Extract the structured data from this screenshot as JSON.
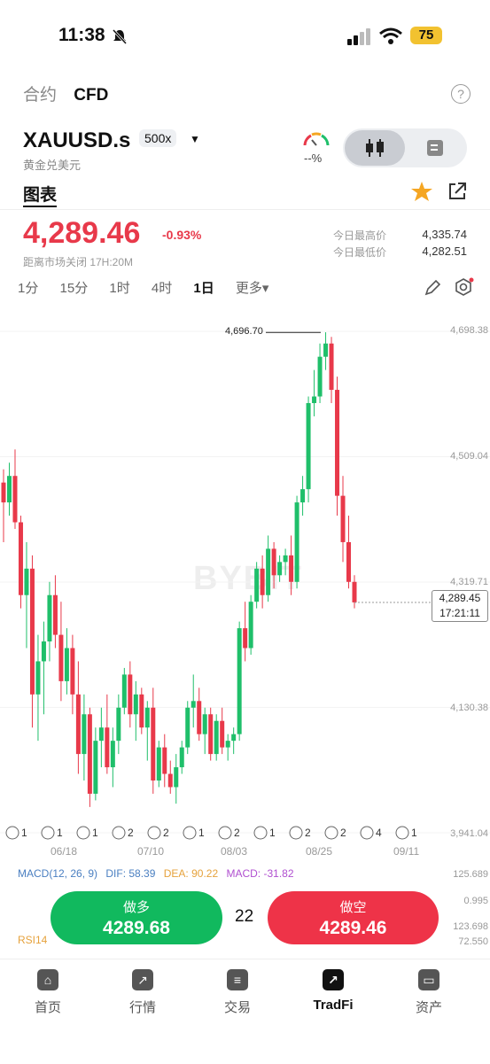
{
  "status": {
    "time": "11:38",
    "battery": "75"
  },
  "header": {
    "tabs": [
      "合约",
      "CFD"
    ],
    "active_tab": 1
  },
  "symbol": {
    "name": "XAUUSD.s",
    "leverage": "500x",
    "description": "黄金兑美元",
    "sentiment": "--%"
  },
  "chart_tab": "图表",
  "quote": {
    "price": "4,289.46",
    "change": "-0.93%",
    "close_note": "距离市场关闭 17H:20M",
    "high_label": "今日最高价",
    "high": "4,335.74",
    "low_label": "今日最低价",
    "low": "4,282.51"
  },
  "intervals": [
    "1分",
    "15分",
    "1时",
    "4时",
    "1日",
    "更多▾"
  ],
  "active_interval": "1日",
  "chart_data": {
    "type": "candlestick",
    "ylim": [
      3941.04,
      4698.38
    ],
    "y_ticks": [
      "4,698.38",
      "4,509.04",
      "4,319.71",
      "4,130.38",
      "3,941.04"
    ],
    "x_ticks": [
      "06/18",
      "07/10",
      "08/03",
      "08/25",
      "09/11"
    ],
    "peak_label": "4,696.70",
    "last_price": "4,289.45",
    "countdown": "17:21:11",
    "watermark": "BYBIT",
    "candles": [
      [
        4470,
        4490,
        4380,
        4440
      ],
      [
        4440,
        4500,
        4420,
        4480
      ],
      [
        4480,
        4520,
        4400,
        4410
      ],
      [
        4410,
        4420,
        4280,
        4300
      ],
      [
        4300,
        4380,
        4220,
        4340
      ],
      [
        4340,
        4360,
        4100,
        4150
      ],
      [
        4150,
        4240,
        4080,
        4200
      ],
      [
        4200,
        4260,
        4120,
        4230
      ],
      [
        4230,
        4320,
        4200,
        4300
      ],
      [
        4300,
        4330,
        4220,
        4240
      ],
      [
        4240,
        4290,
        4140,
        4170
      ],
      [
        4170,
        4250,
        4150,
        4220
      ],
      [
        4220,
        4240,
        4120,
        4150
      ],
      [
        4150,
        4200,
        4030,
        4060
      ],
      [
        4060,
        4150,
        4020,
        4120
      ],
      [
        4120,
        4130,
        3980,
        4000
      ],
      [
        4000,
        4100,
        3990,
        4080
      ],
      [
        4080,
        4130,
        4040,
        4100
      ],
      [
        4100,
        4150,
        4030,
        4040
      ],
      [
        4040,
        4100,
        4010,
        4080
      ],
      [
        4080,
        4150,
        4060,
        4130
      ],
      [
        4130,
        4190,
        4120,
        4180
      ],
      [
        4180,
        4200,
        4100,
        4120
      ],
      [
        4120,
        4170,
        4080,
        4150
      ],
      [
        4150,
        4160,
        4090,
        4100
      ],
      [
        4100,
        4140,
        4050,
        4130
      ],
      [
        4130,
        4160,
        4000,
        4020
      ],
      [
        4020,
        4080,
        4010,
        4070
      ],
      [
        4070,
        4090,
        4010,
        4030
      ],
      [
        4030,
        4050,
        4000,
        4010
      ],
      [
        4010,
        4060,
        3985,
        4040
      ],
      [
        4040,
        4080,
        4030,
        4070
      ],
      [
        4070,
        4140,
        4060,
        4130
      ],
      [
        4130,
        4180,
        4100,
        4140
      ],
      [
        4140,
        4160,
        4080,
        4090
      ],
      [
        4090,
        4130,
        4060,
        4120
      ],
      [
        4120,
        4130,
        4050,
        4060
      ],
      [
        4060,
        4120,
        4050,
        4110
      ],
      [
        4110,
        4130,
        4060,
        4070
      ],
      [
        4070,
        4090,
        4050,
        4080
      ],
      [
        4080,
        4100,
        4060,
        4090
      ],
      [
        4090,
        4260,
        4080,
        4250
      ],
      [
        4250,
        4290,
        4200,
        4220
      ],
      [
        4220,
        4300,
        4210,
        4290
      ],
      [
        4290,
        4350,
        4280,
        4340
      ],
      [
        4340,
        4360,
        4280,
        4300
      ],
      [
        4300,
        4390,
        4290,
        4370
      ],
      [
        4370,
        4380,
        4310,
        4330
      ],
      [
        4330,
        4360,
        4320,
        4350
      ],
      [
        4350,
        4370,
        4330,
        4360
      ],
      [
        4360,
        4390,
        4300,
        4320
      ],
      [
        4320,
        4450,
        4310,
        4440
      ],
      [
        4440,
        4480,
        4420,
        4460
      ],
      [
        4460,
        4600,
        4440,
        4590
      ],
      [
        4590,
        4640,
        4570,
        4600
      ],
      [
        4600,
        4680,
        4590,
        4660
      ],
      [
        4660,
        4697,
        4640,
        4680
      ],
      [
        4680,
        4690,
        4590,
        4610
      ],
      [
        4610,
        4630,
        4420,
        4450
      ],
      [
        4450,
        4480,
        4350,
        4380
      ],
      [
        4380,
        4420,
        4310,
        4320
      ],
      [
        4320,
        4330,
        4280,
        4289
      ]
    ],
    "macd": {
      "label": "MACD(12, 26, 9)",
      "dif": "DIF: 58.39",
      "dea": "DEA: 90.22",
      "macd": "MACD: -31.82",
      "levels": [
        "125.689",
        "0.995",
        "123.698"
      ]
    },
    "rsi": {
      "label": "RSI14",
      "level": "72.550"
    },
    "news_markers": [
      "1",
      "1",
      "1",
      "2",
      "2",
      "1",
      "2",
      "1",
      "2",
      "2",
      "4",
      "1"
    ]
  },
  "trade": {
    "long_label": "做多",
    "long_price": "4289.68",
    "spread": "22",
    "short_label": "做空",
    "short_price": "4289.46"
  },
  "nav": [
    {
      "label": "首页",
      "icon": "home-icon"
    },
    {
      "label": "行情",
      "icon": "chart-icon"
    },
    {
      "label": "交易",
      "icon": "trade-icon"
    },
    {
      "label": "TradFi",
      "icon": "tradfi-icon"
    },
    {
      "label": "资产",
      "icon": "wallet-icon"
    }
  ],
  "active_nav": "TradFi",
  "colors": {
    "up": "#1fbf6a",
    "down": "#e8394a",
    "accent": "#f5a623"
  }
}
